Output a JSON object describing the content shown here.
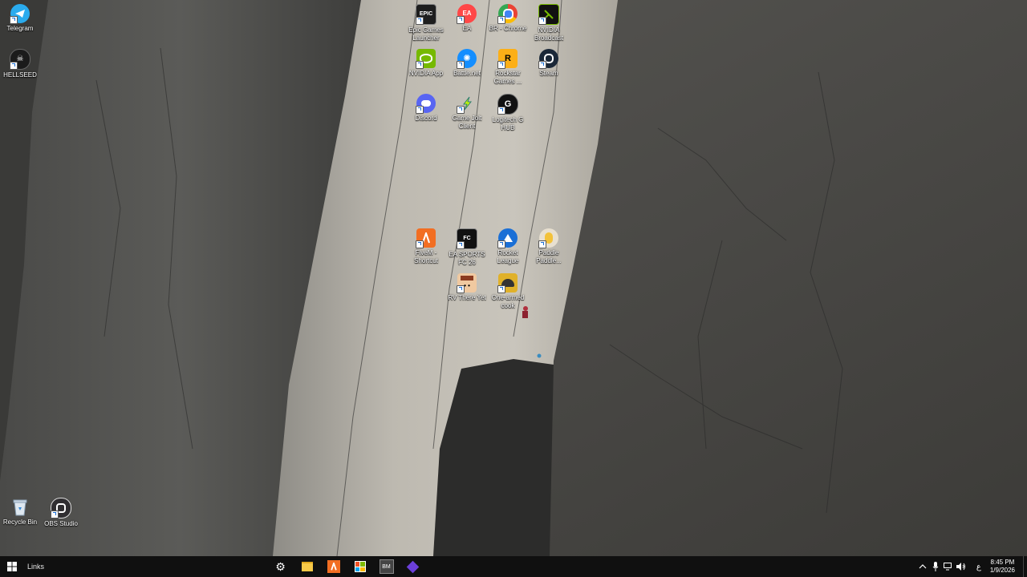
{
  "desktop": {
    "icons": [
      {
        "id": "telegram",
        "label": "Telegram",
        "icon": "telegram-icon",
        "color": "#2AABEE"
      },
      {
        "id": "hellseed",
        "label": "HELLSEED",
        "icon": "hellseed-icon",
        "color": "#222222"
      },
      {
        "id": "epic",
        "label": "Epic Games Launcher",
        "icon": "epic-games-icon",
        "color": "#1e1e1e"
      },
      {
        "id": "ea",
        "label": "EA",
        "icon": "ea-icon",
        "color": "#ff4747"
      },
      {
        "id": "chrome",
        "label": "BR - Chrome",
        "icon": "chrome-icon",
        "color": "#4285F4"
      },
      {
        "id": "nvidia-broadcast",
        "label": "NVIDIA Broadcast",
        "icon": "nvidia-broadcast-icon",
        "color": "#111111"
      },
      {
        "id": "nvidia-app",
        "label": "NVIDIA App",
        "icon": "nvidia-icon",
        "color": "#76B900"
      },
      {
        "id": "battlenet",
        "label": "Battle.net",
        "icon": "battlenet-icon",
        "color": "#148EFF"
      },
      {
        "id": "rockstar",
        "label": "Rockstar Games ...",
        "icon": "rockstar-icon",
        "color": "#FCAF17"
      },
      {
        "id": "steam",
        "label": "Steam",
        "icon": "steam-icon",
        "color": "#1b2838"
      },
      {
        "id": "discord",
        "label": "Discord",
        "icon": "discord-icon",
        "color": "#5865F2"
      },
      {
        "id": "gamejolt",
        "label": "Game Jolt Client",
        "icon": "gamejolt-icon",
        "color": "#2f7f6f"
      },
      {
        "id": "logitech",
        "label": "Logitech G HUB",
        "icon": "logitech-icon",
        "color": "#111111"
      },
      {
        "id": "fivem",
        "label": "FiveM - Shortcut",
        "icon": "fivem-icon",
        "color": "#F26E22"
      },
      {
        "id": "easportsfc",
        "label": "EA SPORTS FC 26",
        "icon": "ea-sports-fc-icon",
        "color": "#111111"
      },
      {
        "id": "rocketleague",
        "label": "Rocket League",
        "icon": "rocket-league-icon",
        "color": "#1a6fd6"
      },
      {
        "id": "paddle",
        "label": "Paddle Paddle...",
        "icon": "paddle-icon",
        "color": "#e8e0d0"
      },
      {
        "id": "rvthere",
        "label": "RV There Yet",
        "icon": "rv-there-yet-icon",
        "color": "#c0392b"
      },
      {
        "id": "onearmed",
        "label": "One-armed cook",
        "icon": "one-armed-cook-icon",
        "color": "#e0b12a"
      },
      {
        "id": "recyclebin",
        "label": "Recycle Bin",
        "icon": "recycle-bin-icon",
        "color": "#c9d6e3"
      },
      {
        "id": "obs",
        "label": "OBS Studio",
        "icon": "obs-icon",
        "color": "#302E31"
      }
    ]
  },
  "taskbar": {
    "links_label": "Links",
    "pinned": [
      {
        "name": "settings",
        "icon": "settings-gear-icon"
      },
      {
        "name": "file-explorer",
        "icon": "folder-icon"
      },
      {
        "name": "fivem",
        "icon": "fivem-icon"
      },
      {
        "name": "microsoft-store",
        "icon": "store-icon"
      },
      {
        "name": "app-bm",
        "icon": "bm-app-icon"
      },
      {
        "name": "app-purple",
        "icon": "purple-diamond-icon"
      }
    ],
    "tray": {
      "language": "ع",
      "time": "8:45 PM",
      "date": "1/9/2026"
    }
  },
  "colors": {
    "taskbar_bg": "#101010",
    "icon_label": "#ffffff"
  }
}
